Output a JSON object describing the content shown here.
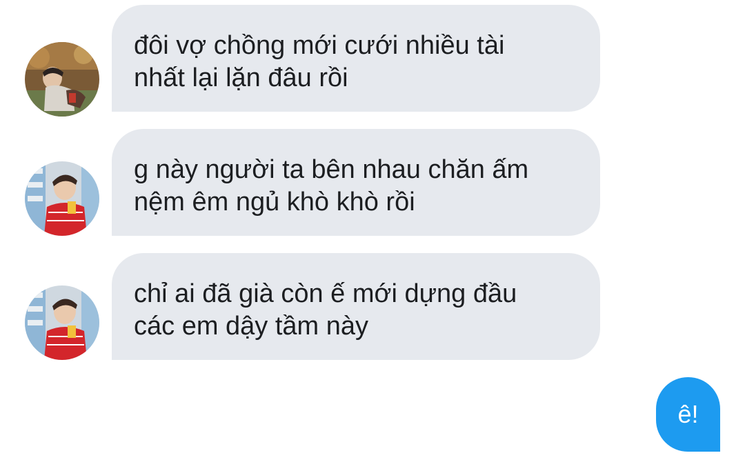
{
  "conversation": {
    "messages": [
      {
        "sender": "other",
        "avatar": "avatar-person-outdoors",
        "text": "đôi vợ chồng mới cưới nhiều tài\nnhất lại lặn đâu rồi"
      },
      {
        "sender": "other",
        "avatar": "avatar-person-red-sweater",
        "text": "g này người ta bên nhau chăn ấm\nnệm êm ngủ khò khò rồi"
      },
      {
        "sender": "other",
        "avatar": "avatar-person-red-sweater",
        "text": "chỉ ai đã già còn ế mới dựng đầu\ncác em dậy tầm này"
      },
      {
        "sender": "self",
        "text": "ê!"
      }
    ]
  },
  "colors": {
    "received_bubble": "#e6e9ee",
    "sent_bubble": "#1d9bf0",
    "received_text": "#1c1e21",
    "sent_text": "#ffffff",
    "background": "#ffffff"
  }
}
